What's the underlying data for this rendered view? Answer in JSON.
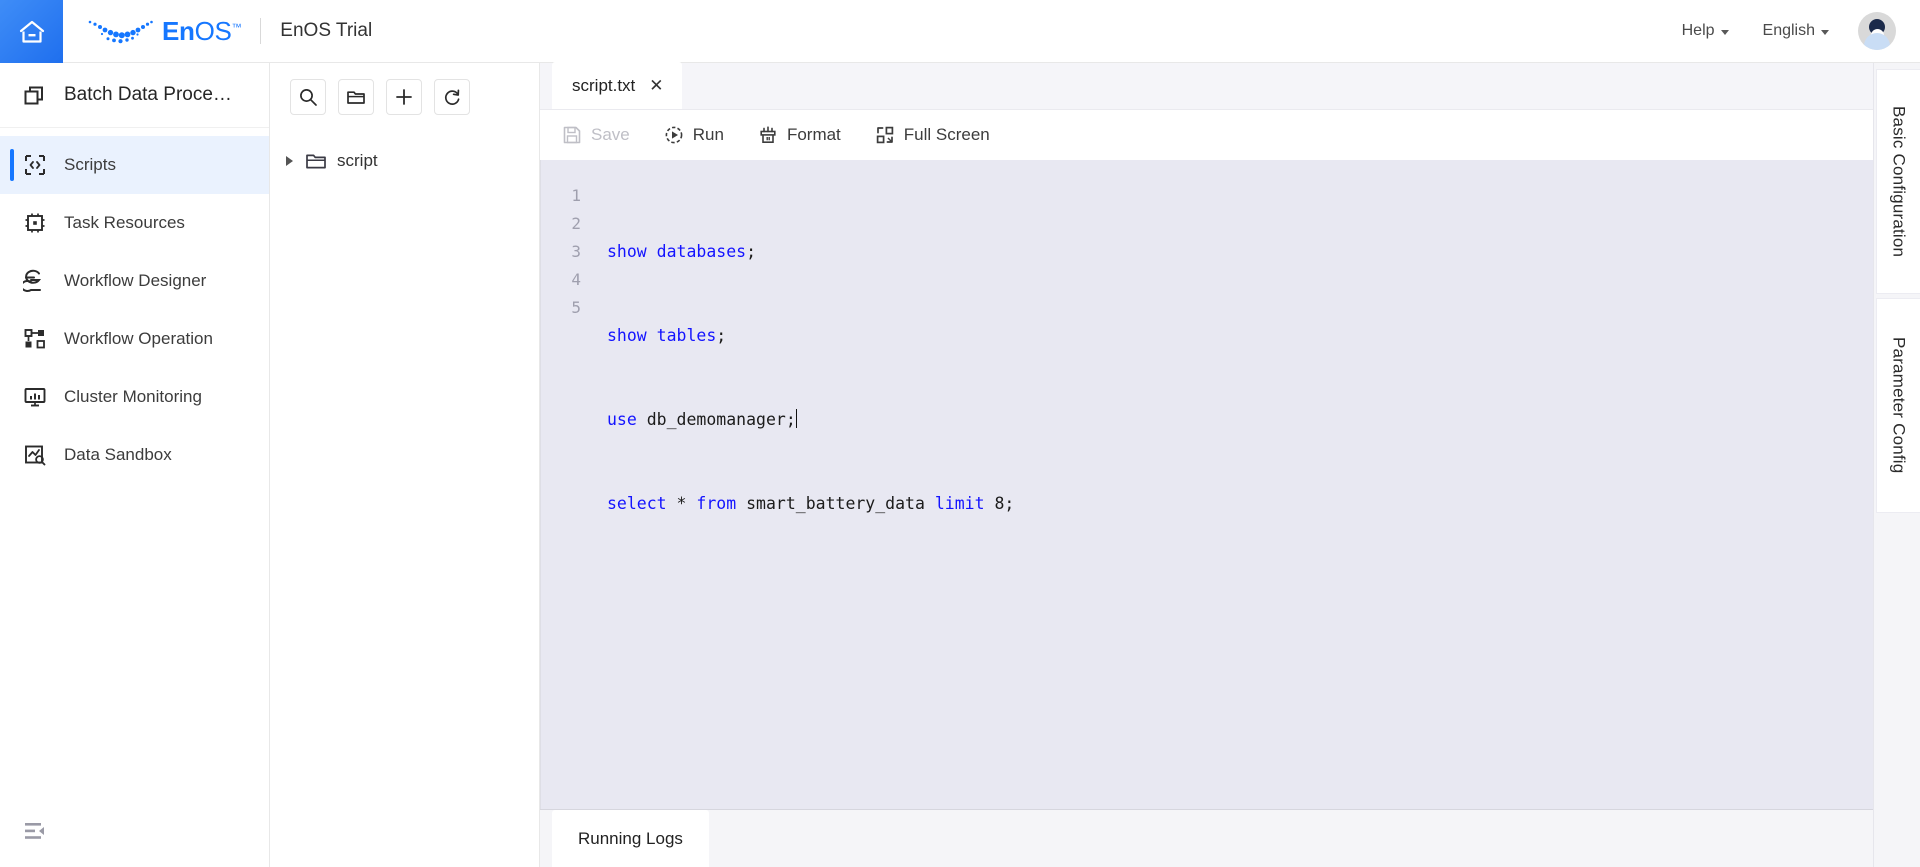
{
  "header": {
    "home_icon": "home-icon",
    "logo_text_en": "En",
    "logo_text_os": "OS",
    "logo_tm": "™",
    "app_title": "EnOS Trial",
    "help_label": "Help",
    "language_label": "English",
    "avatar_icon": "user-avatar"
  },
  "sidebar": {
    "title": "Batch Data Proce…",
    "title_icon": "copy-stack-icon",
    "collapse_icon": "menu-fold-icon",
    "items": [
      {
        "label": "Scripts",
        "icon": "code-brackets-icon",
        "active": true
      },
      {
        "label": "Task Resources",
        "icon": "chip-icon",
        "active": false
      },
      {
        "label": "Workflow Designer",
        "icon": "workflow-designer-icon",
        "active": false
      },
      {
        "label": "Workflow Operation",
        "icon": "workflow-operation-icon",
        "active": false
      },
      {
        "label": "Cluster Monitoring",
        "icon": "monitor-chart-icon",
        "active": false
      },
      {
        "label": "Data Sandbox",
        "icon": "sandbox-search-icon",
        "active": false
      }
    ]
  },
  "file_panel": {
    "toolbar": [
      {
        "name": "search-button",
        "icon": "search-icon"
      },
      {
        "name": "new-folder-button",
        "icon": "folder-icon"
      },
      {
        "name": "add-button",
        "icon": "plus-icon"
      },
      {
        "name": "refresh-button",
        "icon": "refresh-icon"
      }
    ],
    "tree": [
      {
        "label": "script",
        "icon": "folder-icon",
        "expanded": false
      }
    ]
  },
  "editor": {
    "tabs": [
      {
        "label": "script.txt",
        "close_icon": "close-icon",
        "active": true
      }
    ],
    "toolbar": [
      {
        "label": "Save",
        "icon": "save-icon",
        "disabled": true
      },
      {
        "label": "Run",
        "icon": "run-icon",
        "disabled": false
      },
      {
        "label": "Format",
        "icon": "format-brush-icon",
        "disabled": false
      },
      {
        "label": "Full Screen",
        "icon": "fullscreen-icon",
        "disabled": false
      }
    ],
    "line_numbers": [
      "1",
      "2",
      "3",
      "4",
      "5"
    ],
    "code_lines": [
      [
        {
          "t": "show databases",
          "k": true
        },
        {
          "t": ";",
          "k": false
        }
      ],
      [
        {
          "t": "show tables",
          "k": true
        },
        {
          "t": ";",
          "k": false
        }
      ],
      [
        {
          "t": "use",
          "k": true
        },
        {
          "t": " db_demomanager;",
          "k": false
        }
      ],
      [
        {
          "t": "select",
          "k": true
        },
        {
          "t": " * ",
          "k": false
        },
        {
          "t": "from",
          "k": true
        },
        {
          "t": " smart_battery_data ",
          "k": false
        },
        {
          "t": "limit",
          "k": true
        },
        {
          "t": " 8;",
          "k": false
        }
      ],
      [
        {
          "t": "",
          "k": false
        }
      ]
    ],
    "code_plain": [
      "show databases;",
      "show tables;",
      "use db_demomanager;",
      "select * from smart_battery_data limit 8;",
      ""
    ],
    "cursor_line": 3
  },
  "logs": {
    "tab_label": "Running Logs"
  },
  "right_rail": {
    "tabs": [
      {
        "label": "Basic Configuration"
      },
      {
        "label": "Parameter Config"
      }
    ]
  },
  "colors": {
    "brand_blue": "#1677ff",
    "active_bg": "#eaf2fe",
    "editor_bg": "#e8e8f2",
    "keyword_blue": "#1414ff",
    "panel_bg": "#f5f5f8"
  }
}
